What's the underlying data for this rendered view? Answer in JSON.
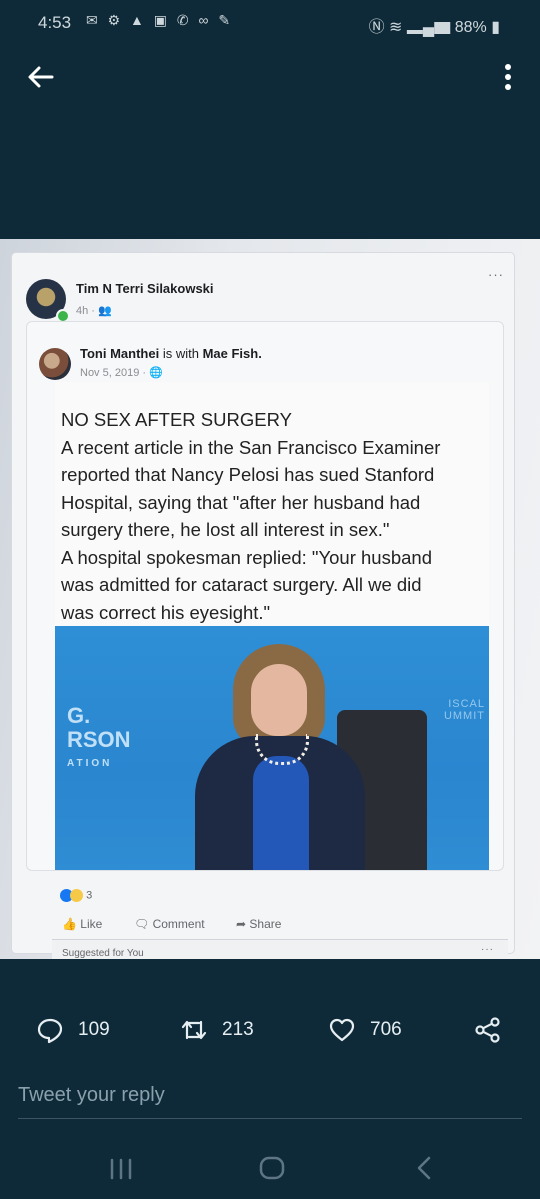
{
  "status_bar": {
    "time": "4:53",
    "battery": "88%"
  },
  "post_image": {
    "fb_post": {
      "author": "Tim N Terri Silakowski",
      "time": "4h ·",
      "more": "···",
      "shared_post": {
        "author": "Toni Manthei",
        "with_text": "is with",
        "with_name": "Mae Fish.",
        "date": "Nov 5, 2019 ·",
        "meme_lines": [
          "NO SEX AFTER SURGERY",
          "A recent article in the San Francisco Examiner",
          "reported that Nancy Pelosi has sued Stanford",
          "Hospital, saying that \"after her husband had",
          "surgery there, he lost all interest in sex.\"",
          "A hospital spokesman replied: \"Your husband",
          "was admitted for cataract surgery. All we did",
          "was correct his eyesight.\""
        ],
        "backdrop": {
          "line1": "G.",
          "line2": "RSON",
          "line3": "ATION",
          "summit1": "ISCAL",
          "summit2": "UMMIT"
        }
      },
      "reaction_count": "3",
      "actions": {
        "like": "Like",
        "comment": "Comment",
        "share": "Share"
      },
      "suggested": "Suggested for You"
    }
  },
  "tweet_stats": {
    "replies": "109",
    "retweets": "213",
    "likes": "706"
  },
  "reply_box": {
    "placeholder": "Tweet your reply"
  },
  "colors": {
    "background": "#0e2a38",
    "stat_text": "#e6eef2",
    "fb_blue": "#1877f2"
  }
}
